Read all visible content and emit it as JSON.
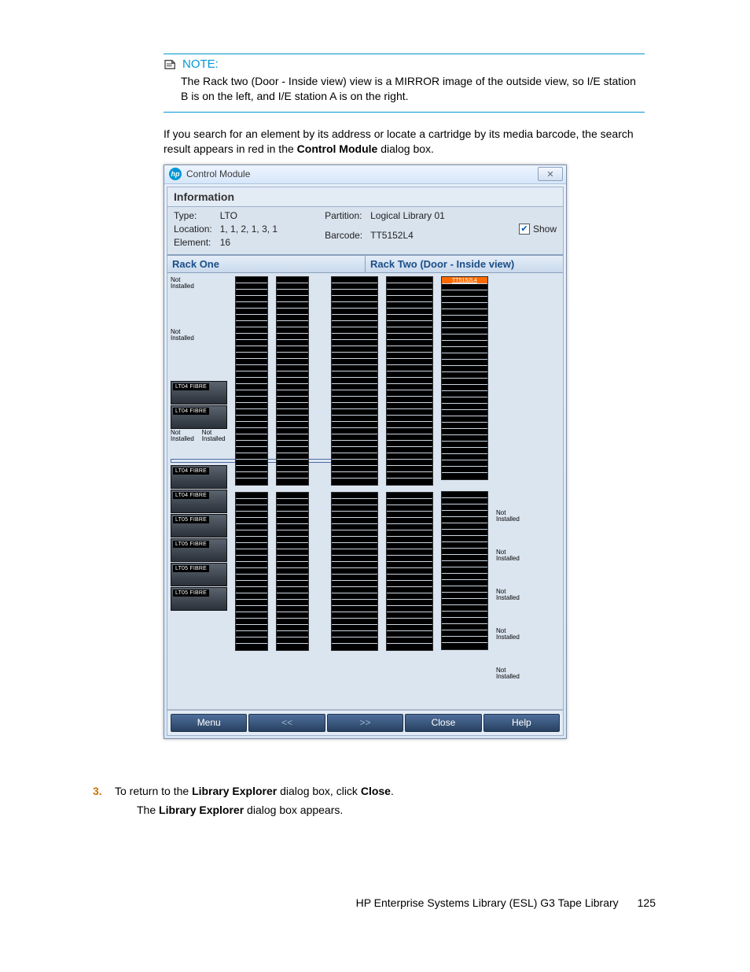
{
  "note": {
    "label": "NOTE:",
    "body1": "The Rack two (Door - Inside view) view is a MIRROR image of the outside view, so I/E station B is on the left, and I/E station A is on the right."
  },
  "para1_a": "If you search for an element by its address or locate a cartridge by its media barcode, the search result appears in red in the ",
  "para1_b": "Control Module",
  "para1_c": " dialog box.",
  "dialog": {
    "title": "Control Module",
    "close_glyph": "✕",
    "info_title": "Information",
    "labels": {
      "type": "Type:",
      "location": "Location:",
      "element": "Element:",
      "partition": "Partition:",
      "barcode": "Barcode:",
      "show": "Show"
    },
    "values": {
      "type": "LTO",
      "location": "1, 1, 2, 1, 3, 1",
      "element": "16",
      "partition": "Logical Library 01",
      "barcode": "TT5152L4"
    },
    "rack_one": "Rack One",
    "rack_two": "Rack Two (Door - Inside view)",
    "not_installed": "Not\nInstalled",
    "highlight": "TT5152L4",
    "drives_top": [
      "LT04 FIBRE",
      "LT04 FIBRE"
    ],
    "drives_bottom": [
      "LT04 FIBRE",
      "LT04 FIBRE",
      "LT05 FIBRE",
      "LT05 FIBRE",
      "LT05 FIBRE",
      "LT05 FIBRE"
    ],
    "buttons": {
      "menu": "Menu",
      "prev": "<<",
      "next": ">>",
      "close": "Close",
      "help": "Help"
    }
  },
  "step": {
    "num": "3.",
    "text_a": "To return to the ",
    "text_b": "Library Explorer",
    "text_c": " dialog box, click ",
    "text_d": "Close",
    "text_e": ".",
    "after_a": "The ",
    "after_b": "Library Explorer",
    "after_c": " dialog box appears."
  },
  "footer": {
    "text": "HP Enterprise Systems Library (ESL) G3 Tape Library",
    "page": "125"
  }
}
